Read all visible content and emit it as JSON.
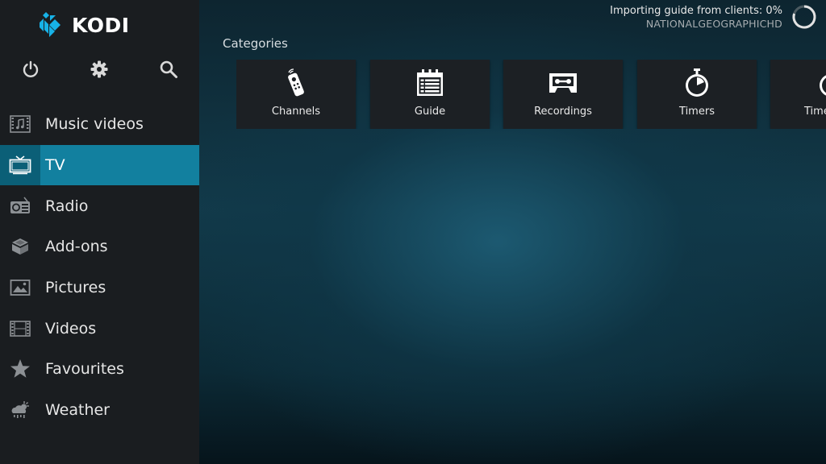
{
  "app": {
    "logo_text": "KODI",
    "brand_colors": {
      "blue": "#17b2e7",
      "dark_blue": "#12809f"
    }
  },
  "top_icons": [
    {
      "name": "power-icon"
    },
    {
      "name": "gear-icon"
    },
    {
      "name": "search-icon"
    }
  ],
  "sidebar": {
    "items": [
      {
        "label": "Music videos",
        "icon": "music-video-icon",
        "active": false
      },
      {
        "label": "TV",
        "icon": "tv-icon",
        "active": true
      },
      {
        "label": "Radio",
        "icon": "radio-icon",
        "active": false
      },
      {
        "label": "Add-ons",
        "icon": "addons-box-icon",
        "active": false
      },
      {
        "label": "Pictures",
        "icon": "pictures-icon",
        "active": false
      },
      {
        "label": "Videos",
        "icon": "film-icon",
        "active": false
      },
      {
        "label": "Favourites",
        "icon": "star-icon",
        "active": false
      },
      {
        "label": "Weather",
        "icon": "weather-icon",
        "active": false
      }
    ]
  },
  "status": {
    "line1": "Importing guide from clients:  0%",
    "line2": "NATIONALGEOGRAPHICHD",
    "progress_percent": 0
  },
  "main": {
    "heading": "Categories",
    "tiles": [
      {
        "label": "Channels",
        "icon": "remote-icon"
      },
      {
        "label": "Guide",
        "icon": "calendar-icon"
      },
      {
        "label": "Recordings",
        "icon": "cassette-icon"
      },
      {
        "label": "Timers",
        "icon": "stopwatch-icon"
      },
      {
        "label": "Timer rules",
        "icon": "stopwatch-icon"
      }
    ]
  }
}
